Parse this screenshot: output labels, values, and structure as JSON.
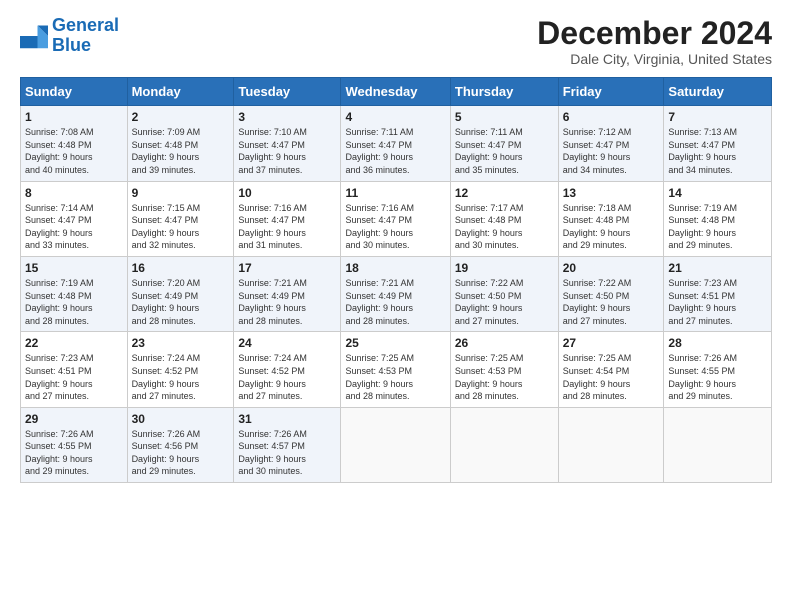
{
  "logo": {
    "line1": "General",
    "line2": "Blue"
  },
  "title": "December 2024",
  "subtitle": "Dale City, Virginia, United States",
  "days_header": [
    "Sunday",
    "Monday",
    "Tuesday",
    "Wednesday",
    "Thursday",
    "Friday",
    "Saturday"
  ],
  "weeks": [
    [
      {
        "day": "1",
        "info": "Sunrise: 7:08 AM\nSunset: 4:48 PM\nDaylight: 9 hours\nand 40 minutes."
      },
      {
        "day": "2",
        "info": "Sunrise: 7:09 AM\nSunset: 4:48 PM\nDaylight: 9 hours\nand 39 minutes."
      },
      {
        "day": "3",
        "info": "Sunrise: 7:10 AM\nSunset: 4:47 PM\nDaylight: 9 hours\nand 37 minutes."
      },
      {
        "day": "4",
        "info": "Sunrise: 7:11 AM\nSunset: 4:47 PM\nDaylight: 9 hours\nand 36 minutes."
      },
      {
        "day": "5",
        "info": "Sunrise: 7:11 AM\nSunset: 4:47 PM\nDaylight: 9 hours\nand 35 minutes."
      },
      {
        "day": "6",
        "info": "Sunrise: 7:12 AM\nSunset: 4:47 PM\nDaylight: 9 hours\nand 34 minutes."
      },
      {
        "day": "7",
        "info": "Sunrise: 7:13 AM\nSunset: 4:47 PM\nDaylight: 9 hours\nand 34 minutes."
      }
    ],
    [
      {
        "day": "8",
        "info": "Sunrise: 7:14 AM\nSunset: 4:47 PM\nDaylight: 9 hours\nand 33 minutes."
      },
      {
        "day": "9",
        "info": "Sunrise: 7:15 AM\nSunset: 4:47 PM\nDaylight: 9 hours\nand 32 minutes."
      },
      {
        "day": "10",
        "info": "Sunrise: 7:16 AM\nSunset: 4:47 PM\nDaylight: 9 hours\nand 31 minutes."
      },
      {
        "day": "11",
        "info": "Sunrise: 7:16 AM\nSunset: 4:47 PM\nDaylight: 9 hours\nand 30 minutes."
      },
      {
        "day": "12",
        "info": "Sunrise: 7:17 AM\nSunset: 4:48 PM\nDaylight: 9 hours\nand 30 minutes."
      },
      {
        "day": "13",
        "info": "Sunrise: 7:18 AM\nSunset: 4:48 PM\nDaylight: 9 hours\nand 29 minutes."
      },
      {
        "day": "14",
        "info": "Sunrise: 7:19 AM\nSunset: 4:48 PM\nDaylight: 9 hours\nand 29 minutes."
      }
    ],
    [
      {
        "day": "15",
        "info": "Sunrise: 7:19 AM\nSunset: 4:48 PM\nDaylight: 9 hours\nand 28 minutes."
      },
      {
        "day": "16",
        "info": "Sunrise: 7:20 AM\nSunset: 4:49 PM\nDaylight: 9 hours\nand 28 minutes."
      },
      {
        "day": "17",
        "info": "Sunrise: 7:21 AM\nSunset: 4:49 PM\nDaylight: 9 hours\nand 28 minutes."
      },
      {
        "day": "18",
        "info": "Sunrise: 7:21 AM\nSunset: 4:49 PM\nDaylight: 9 hours\nand 28 minutes."
      },
      {
        "day": "19",
        "info": "Sunrise: 7:22 AM\nSunset: 4:50 PM\nDaylight: 9 hours\nand 27 minutes."
      },
      {
        "day": "20",
        "info": "Sunrise: 7:22 AM\nSunset: 4:50 PM\nDaylight: 9 hours\nand 27 minutes."
      },
      {
        "day": "21",
        "info": "Sunrise: 7:23 AM\nSunset: 4:51 PM\nDaylight: 9 hours\nand 27 minutes."
      }
    ],
    [
      {
        "day": "22",
        "info": "Sunrise: 7:23 AM\nSunset: 4:51 PM\nDaylight: 9 hours\nand 27 minutes."
      },
      {
        "day": "23",
        "info": "Sunrise: 7:24 AM\nSunset: 4:52 PM\nDaylight: 9 hours\nand 27 minutes."
      },
      {
        "day": "24",
        "info": "Sunrise: 7:24 AM\nSunset: 4:52 PM\nDaylight: 9 hours\nand 27 minutes."
      },
      {
        "day": "25",
        "info": "Sunrise: 7:25 AM\nSunset: 4:53 PM\nDaylight: 9 hours\nand 28 minutes."
      },
      {
        "day": "26",
        "info": "Sunrise: 7:25 AM\nSunset: 4:53 PM\nDaylight: 9 hours\nand 28 minutes."
      },
      {
        "day": "27",
        "info": "Sunrise: 7:25 AM\nSunset: 4:54 PM\nDaylight: 9 hours\nand 28 minutes."
      },
      {
        "day": "28",
        "info": "Sunrise: 7:26 AM\nSunset: 4:55 PM\nDaylight: 9 hours\nand 29 minutes."
      }
    ],
    [
      {
        "day": "29",
        "info": "Sunrise: 7:26 AM\nSunset: 4:55 PM\nDaylight: 9 hours\nand 29 minutes."
      },
      {
        "day": "30",
        "info": "Sunrise: 7:26 AM\nSunset: 4:56 PM\nDaylight: 9 hours\nand 29 minutes."
      },
      {
        "day": "31",
        "info": "Sunrise: 7:26 AM\nSunset: 4:57 PM\nDaylight: 9 hours\nand 30 minutes."
      },
      null,
      null,
      null,
      null
    ]
  ]
}
